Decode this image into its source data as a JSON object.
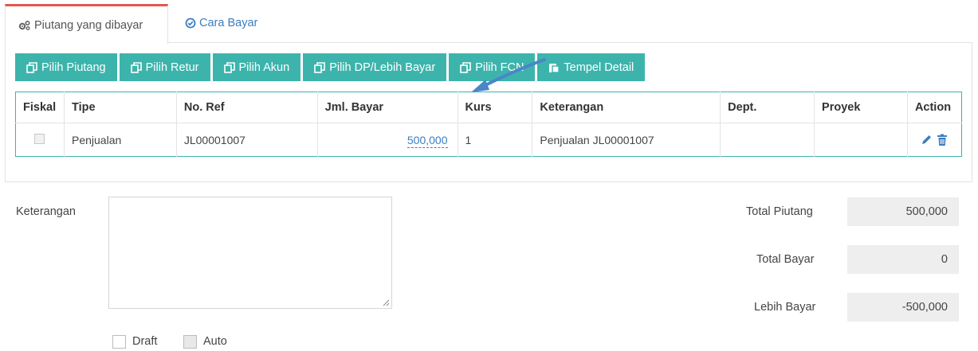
{
  "tabs": [
    {
      "label": "Piutang yang dibayar",
      "active": true,
      "icon": "gears-icon"
    },
    {
      "label": "Cara Bayar",
      "active": false,
      "icon": "check-circle-icon"
    }
  ],
  "toolbar": {
    "buttons": [
      {
        "label": "Pilih Piutang",
        "icon": "copy-icon"
      },
      {
        "label": "Pilih Retur",
        "icon": "copy-icon"
      },
      {
        "label": "Pilih Akun",
        "icon": "copy-icon"
      },
      {
        "label": "Pilih DP/Lebih Bayar",
        "icon": "copy-icon"
      },
      {
        "label": "Pilih FCN",
        "icon": "copy-icon"
      },
      {
        "label": "Tempel Detail",
        "icon": "paste-icon"
      }
    ]
  },
  "table": {
    "columns": [
      "Fiskal",
      "Tipe",
      "No. Ref",
      "Jml. Bayar",
      "Kurs",
      "Keterangan",
      "Dept.",
      "Proyek",
      "Action"
    ],
    "rows": [
      {
        "fiskal": false,
        "tipe": "Penjualan",
        "no_ref": "JL00001007",
        "jml_bayar": "500,000",
        "kurs": "1",
        "keterangan": "Penjualan JL00001007",
        "dept": "",
        "proyek": ""
      }
    ]
  },
  "form": {
    "keterangan_label": "Keterangan",
    "keterangan_value": "",
    "draft_label": "Draft",
    "auto_label": "Auto",
    "draft_checked": false,
    "auto_checked": false
  },
  "totals": {
    "total_piutang_label": "Total Piutang",
    "total_piutang": "500,000",
    "total_bayar_label": "Total Bayar",
    "total_bayar": "0",
    "lebih_bayar_label": "Lebih Bayar",
    "lebih_bayar": "-500,000"
  },
  "colors": {
    "accent": "#3cb4ac",
    "tab_highlight": "#e05a4f",
    "link": "#3c7ec1",
    "annotation_arrow": "#4a86c8"
  }
}
